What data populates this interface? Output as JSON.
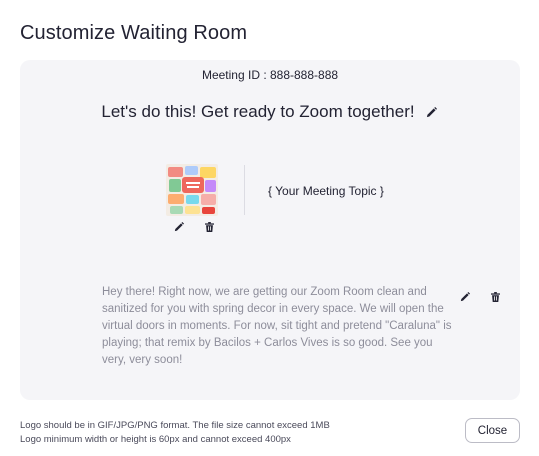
{
  "dialog": {
    "title": "Customize Waiting Room",
    "close_label": "Close"
  },
  "preview": {
    "meeting_id": "Meeting ID : 888-888-888",
    "headline": "Let's do this! Get ready to Zoom together!",
    "topic": "{ Your Meeting Topic }",
    "description": "Hey there! Right now, we are getting our Zoom Room clean and sanitized for you with spring decor in every space. We will open the virtual doors in moments. For now, sit tight and pretend \"Caraluna\" is playing; that remix by Bacilos + Carlos Vives is so good. See you very, very soon!"
  },
  "footnote": {
    "line1": "Logo should be in GIF/JPG/PNG format. The file size cannot exceed 1MB",
    "line2": "Logo minimum width or height is 60px and cannot exceed 400px"
  },
  "icons": {
    "edit": "pencil-icon",
    "delete": "trash-icon"
  },
  "colors": {
    "panel_bg": "#f5f5f8",
    "text_primary": "#232333",
    "text_muted": "#8d8d9a",
    "button_border": "#bcbcc6"
  }
}
